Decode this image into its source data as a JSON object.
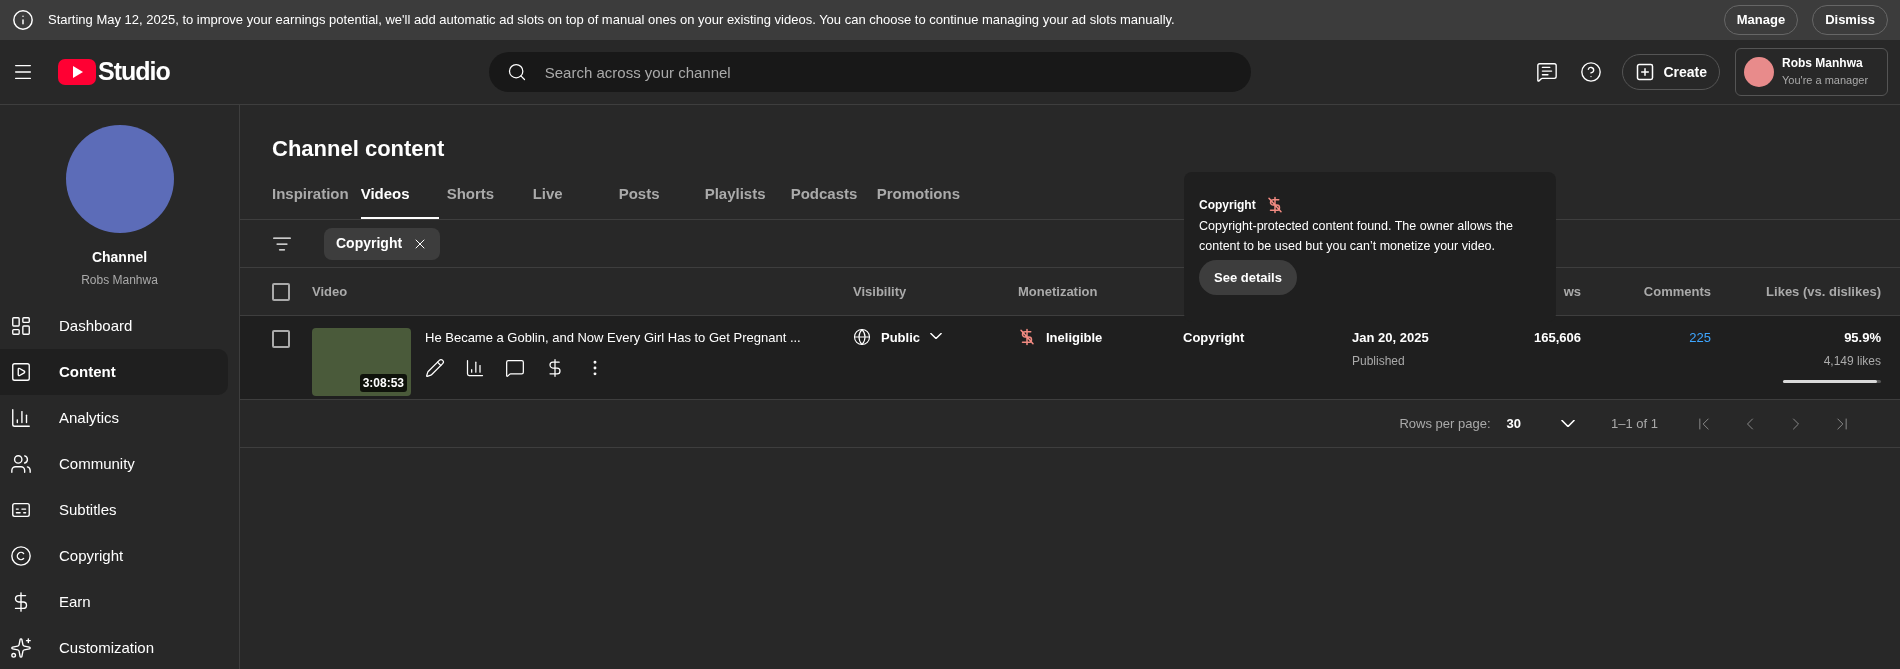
{
  "banner": {
    "text": "Starting May 12, 2025, to improve your earnings potential, we'll add automatic ad slots on top of manual ones on your existing videos. You can choose to continue managing your ad slots manually.",
    "buttons": [
      "Manage",
      "Dismiss"
    ]
  },
  "header": {
    "logo_text": "Studio",
    "search_placeholder": "Search across your channel",
    "create_label": "Create",
    "account": {
      "name": "Robs Manhwa",
      "role": "You're a manager"
    }
  },
  "sidebar": {
    "channel_label": "Channel",
    "channel_name": "Robs Manhwa",
    "items": [
      {
        "label": "Dashboard",
        "selected": false
      },
      {
        "label": "Content",
        "selected": true
      },
      {
        "label": "Analytics",
        "selected": false
      },
      {
        "label": "Community",
        "selected": false
      },
      {
        "label": "Subtitles",
        "selected": false
      },
      {
        "label": "Copyright",
        "selected": false
      },
      {
        "label": "Earn",
        "selected": false
      },
      {
        "label": "Customization",
        "selected": false
      }
    ]
  },
  "page": {
    "title": "Channel content",
    "tabs": [
      {
        "label": "Inspiration",
        "selected": false
      },
      {
        "label": "Videos",
        "selected": true
      },
      {
        "label": "Shorts",
        "selected": false
      },
      {
        "label": "Live",
        "selected": false
      },
      {
        "label": "Posts",
        "selected": false
      },
      {
        "label": "Playlists",
        "selected": false
      },
      {
        "label": "Podcasts",
        "selected": false
      },
      {
        "label": "Promotions",
        "selected": false
      }
    ],
    "filter_chip": "Copyright"
  },
  "table": {
    "header_checked": false,
    "columns": [
      "Video",
      "Visibility",
      "Monetization",
      "ws",
      "Comments",
      "Likes (vs. dislikes)"
    ],
    "rows": [
      {
        "checked": false,
        "title": "He Became a Goblin, and Now Every Girl Has to Get Pregnant ...",
        "duration": "3:08:53",
        "visibility": "Public",
        "monetization": "Ineligible",
        "restrictions": "Copyright",
        "date": "Jan 20, 2025",
        "date_status": "Published",
        "views": "165,606",
        "comments": "225",
        "likes_percent": "95.9%",
        "likes_count": "4,149 likes",
        "level": 0.959
      }
    ]
  },
  "pagination": {
    "rows_per_page_label": "Rows per page:",
    "rows_per_page": "30",
    "range": "1–1 of 1"
  },
  "tooltip": {
    "title": "Copyright",
    "text": "Copyright-protected content found. The owner allows the content to be used but you can’t monetize your video.",
    "button": "See details"
  }
}
